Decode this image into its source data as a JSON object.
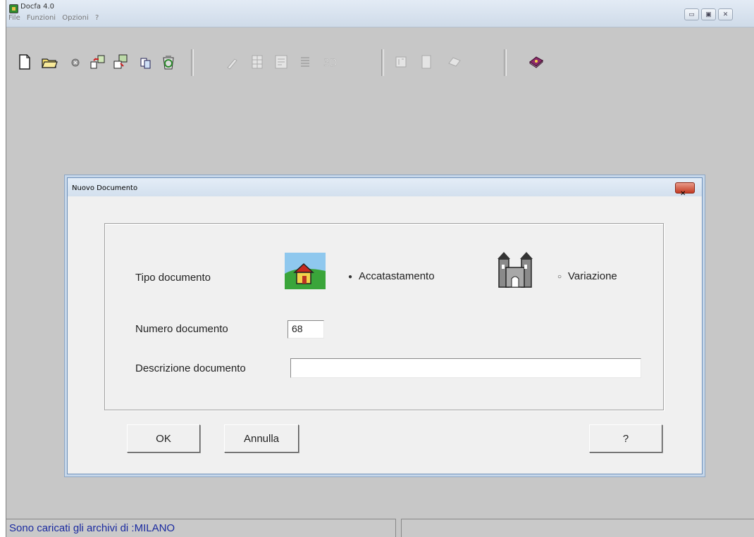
{
  "app": {
    "title": "Docfa 4.0",
    "menu": [
      "File",
      "Funzioni",
      "Opzioni",
      "?"
    ]
  },
  "toolbar": {
    "icons": [
      "new-document-icon",
      "open-folder-icon",
      "stop-icon",
      "export-icon",
      "import-icon",
      "copy-icon",
      "recycle-icon",
      "brush-icon",
      "grid-icon",
      "form-icon",
      "list-icon",
      "3d-icon",
      "page-icon",
      "sheet-icon",
      "print-icon",
      "help-book-icon"
    ]
  },
  "dialog": {
    "title": "Nuovo Documento",
    "close_label": "✕",
    "tipo_label": "Tipo documento",
    "option_accatastamento": "Accatastamento",
    "option_variazione": "Variazione",
    "selected_option": "Accatastamento",
    "numero_label": "Numero documento",
    "numero_value": "68",
    "descrizione_label": "Descrizione documento",
    "descrizione_value": "",
    "ok_label": "OK",
    "annulla_label": "Annulla",
    "help_label": "?"
  },
  "statusbar": {
    "message": "Sono caricati gli archivi di :MILANO",
    "right": ""
  }
}
